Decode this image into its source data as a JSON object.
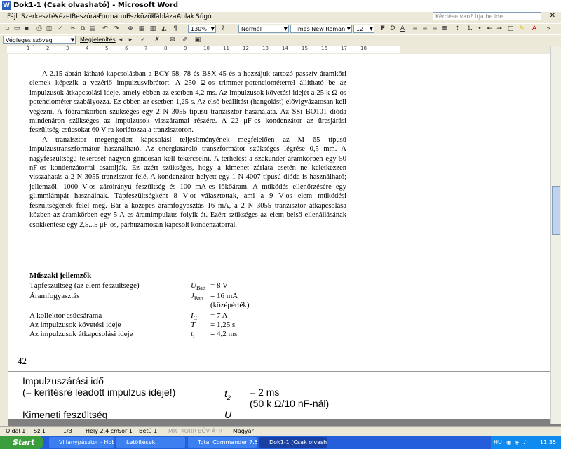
{
  "window": {
    "title": "Dok1-1 (Csak olvasható) - Microsoft Word"
  },
  "menu": [
    "Fájl",
    "Szerkesztés",
    "Nézet",
    "Beszúrás",
    "Formátum",
    "Eszközök",
    "Táblázat",
    "Ablak",
    "Súgó"
  ],
  "help_placeholder": "Kérdése van? Írja be ide.",
  "toolbar": {
    "zoom": "130%",
    "style": "Normál",
    "font": "Times New Roman",
    "size": "12"
  },
  "review_toolbar": {
    "view": "Végleges szöveg korrektúrával",
    "show": "Megjelenítés"
  },
  "ruler_numbers": [
    "1",
    "2",
    "3",
    "4",
    "5",
    "6",
    "7",
    "8",
    "9",
    "10",
    "11",
    "12",
    "13",
    "14",
    "15",
    "16",
    "17",
    "18"
  ],
  "doc": {
    "paragraphs": [
      "A 2.15 ábrán látható kapcsolásban a BCY 58, 78 és BSX 45 és a hozzájuk tartozó passzív áramköri elemek képezik a vezérlő impulzusvibrátort. A 250 Ω-os trimmer-potenciométerrel állítható be az impulzusok átkapcsolási ideje, amely ebben az esetben 4,2 ms. Az impulzusok követési idejét a 25 k Ω-os potenciométer szabályozza. Ez ebben az esetben 1,25 s. Az első beállítást (hangolást) elővigyázatosan kell végezni. A főáramkörben szükséges egy 2 N 3055 típusú tranzisztor használata. Az SSi BO101 dióda mindenáron szükséges az impulzusok visszáramai részére. A 22 μF-os kondenzátor az üresjárási feszültség-csúcsokat 60 V-ra korlátozza a tranzisztoron.",
      "A tranzisztor megengedett kapcsolási teljesítményének megfelelően az M 65 típusú impulzustranszformátor használható. Az energiatároló transzformátor szükséges légrése 0,5 mm. A nagyfeszültségű tekercset nagyon gondosan kell tekercselni. A terhelést a szekunder áramkörben egy 50 nF-os kondenzátorral csatolják. Ez azért szükséges, hogy a kimenet zárlata esetén ne keletkezzen visszahatás a 2 N 3055 tranzisztor felé. A kondenzátor helyett egy 1 N 4007 típusú dióda is használható; jellemzői: 1000 V-os záróirányú feszültség és 100 mA-es lökőáram. A működés ellenőrzésére egy glimmlámpát használnak. Tápfeszültségként 8 V-ot választottak, ami a 9 V-os elem működési feszültségének felel meg. Bár a közepes áramfogyasztás 16 mA, a 2 N 3055 tranzisztor átkapcsolása közben az áramkörben egy 5 A-es áramimpulzus folyik át. Ezért szükséges az elem belső ellenállásának csökkentése egy 2,5...5 μF-os, párhuzamosan kapcsolt kondenzátorral."
    ],
    "spec_title": "Műszaki jellemzők",
    "specs": [
      {
        "label": "Tápfeszültség (az elem feszültsége)",
        "sym": "U",
        "sub": "Batt",
        "val": "= 8 V"
      },
      {
        "label": "Áramfogyasztás",
        "sym": "J",
        "sub": "Batt",
        "val": "= 16 mA"
      },
      {
        "label": "",
        "sym": "",
        "sub": "",
        "val": "(középérték)"
      },
      {
        "label": "A kollektor csúcsárama",
        "sym": "I",
        "sub": "C",
        "val": "= 7 A"
      },
      {
        "label": "Az impulzusok követési ideje",
        "sym": "T",
        "sub": "",
        "val": "= 1,25 s"
      },
      {
        "label": "Az impulzusok átkapcsolási ideje",
        "sym": "t",
        "sub": "i",
        "val": "= 4,2 ms"
      }
    ],
    "page_number": "42",
    "next_page": {
      "line1": "Impulzuszárási idő",
      "line2": "(= kerítésre leadott impulzus ideje!)",
      "sym": "t",
      "sub": "2",
      "val": "= 2 ms",
      "note": "(50 k Ω/10 nF-nál)",
      "line3": "Kimeneti feszültség",
      "sym3": "U"
    }
  },
  "status": {
    "page": "Oldal 1",
    "section": "Sz 1",
    "pages": "1/3",
    "position": "Hely 2,4 cm",
    "line": "Sor 1",
    "column": "Betű 1",
    "flags": [
      "MR",
      "KORR",
      "BŐV",
      "ÁTR"
    ],
    "language": "Magyar"
  },
  "taskbar": {
    "start": "Start",
    "tasks": [
      "Villanypásztor - Hobbi...",
      "Letöltések",
      "Total Commander 7.5...",
      "Dok1-1 (Csak olvasha..."
    ],
    "lang": "HU",
    "clock": "11:35"
  }
}
